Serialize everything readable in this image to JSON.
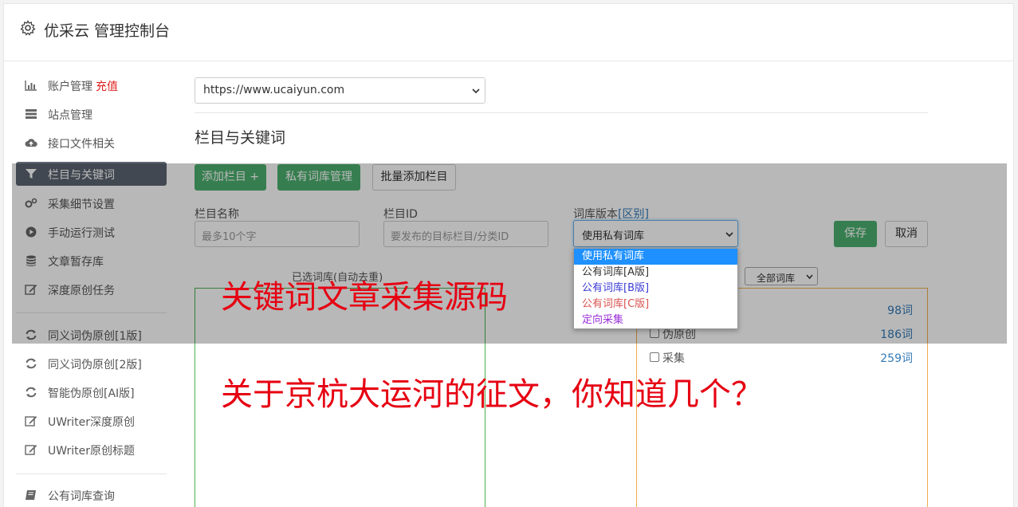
{
  "app": {
    "title": "优采云 管理控制台",
    "icon": "gear-icon"
  },
  "sidebar": {
    "items": [
      {
        "label": "账户管理",
        "badge": "充值",
        "icon": "bar-chart-icon"
      },
      {
        "label": "站点管理",
        "icon": "server-icon"
      },
      {
        "label": "接口文件相关",
        "icon": "cloud-upload-icon"
      },
      {
        "label": "栏目与关键词",
        "icon": "filter-icon",
        "active": true
      },
      {
        "label": "采集细节设置",
        "icon": "gears-icon"
      },
      {
        "label": "手动运行测试",
        "icon": "play-circle-icon"
      },
      {
        "label": "文章暂存库",
        "icon": "database-icon"
      },
      {
        "label": "深度原创任务",
        "icon": "edit-icon"
      },
      {
        "label": "同义词伪原创[1版]",
        "icon": "refresh-icon"
      },
      {
        "label": "同义词伪原创[2版]",
        "icon": "refresh-icon"
      },
      {
        "label": "智能伪原创[AI版]",
        "icon": "refresh-icon"
      },
      {
        "label": "UWriter深度原创",
        "icon": "edit-icon"
      },
      {
        "label": "UWriter原创标题",
        "icon": "edit-icon"
      },
      {
        "label": "公有词库查询",
        "icon": "book-icon"
      }
    ]
  },
  "main": {
    "site_select": {
      "value": "https://www.ucaiyun.com"
    },
    "section_title": "栏目与关键词",
    "toolbar": {
      "add_column": "添加栏目 +",
      "private_lib": "私有词库管理",
      "batch_add": "批量添加栏目"
    },
    "form": {
      "name_label": "栏目名称",
      "name_placeholder": "最多10个字",
      "id_label": "栏目ID",
      "id_placeholder": "要发布的目标栏目/分类ID",
      "lib_label": "词库版本",
      "lib_link": "[区别]",
      "lib_value": "使用私有词库",
      "save": "保存",
      "cancel": "取消"
    },
    "lib_options": [
      {
        "label": "使用私有词库",
        "color": "#ffffff",
        "selected": true
      },
      {
        "label": "公有词库[A版]",
        "color": "#333333"
      },
      {
        "label": "公有词库[B版]",
        "color": "#3b3bd6"
      },
      {
        "label": "公有词库[C版]",
        "color": "#d9534f"
      },
      {
        "label": "定向采集",
        "color": "#9b30d9"
      }
    ],
    "selected_header": "已选词库(自动去重)",
    "filter_select": "全部词库",
    "libraries": [
      {
        "name": "",
        "count": "98词"
      },
      {
        "name": "伪原创",
        "count": "186词"
      },
      {
        "name": "采集",
        "count": "259词"
      }
    ]
  },
  "watermarks": {
    "line1": "关键词文章采集源码",
    "line2": "关于京杭大运河的征文，你知道几个？"
  },
  "colors": {
    "accent_green": "#4caf6e",
    "active_nav": "#5c6471",
    "link": "#337ab7",
    "watermark": "#e60012"
  }
}
